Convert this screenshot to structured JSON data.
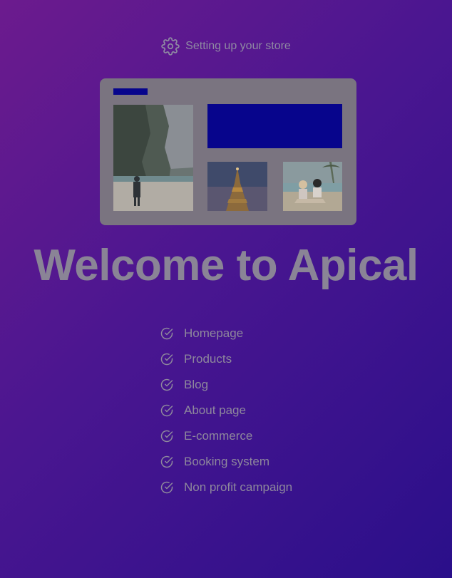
{
  "status": {
    "icon": "gear-icon",
    "text": "Setting up your store"
  },
  "preview": {
    "colors": {
      "card": "#7a7480",
      "accent": "#07058c"
    },
    "images": [
      "beach-cliff-photo",
      "eiffel-tower-photo",
      "friends-beach-photo"
    ]
  },
  "headline": "Welcome to Apical",
  "features": [
    {
      "icon": "check-circle-icon",
      "label": "Homepage"
    },
    {
      "icon": "check-circle-icon",
      "label": "Products"
    },
    {
      "icon": "check-circle-icon",
      "label": "Blog"
    },
    {
      "icon": "check-circle-icon",
      "label": "About page"
    },
    {
      "icon": "check-circle-icon",
      "label": "E-commerce"
    },
    {
      "icon": "check-circle-icon",
      "label": "Booking system"
    },
    {
      "icon": "check-circle-icon",
      "label": "Non profit campaign"
    }
  ]
}
